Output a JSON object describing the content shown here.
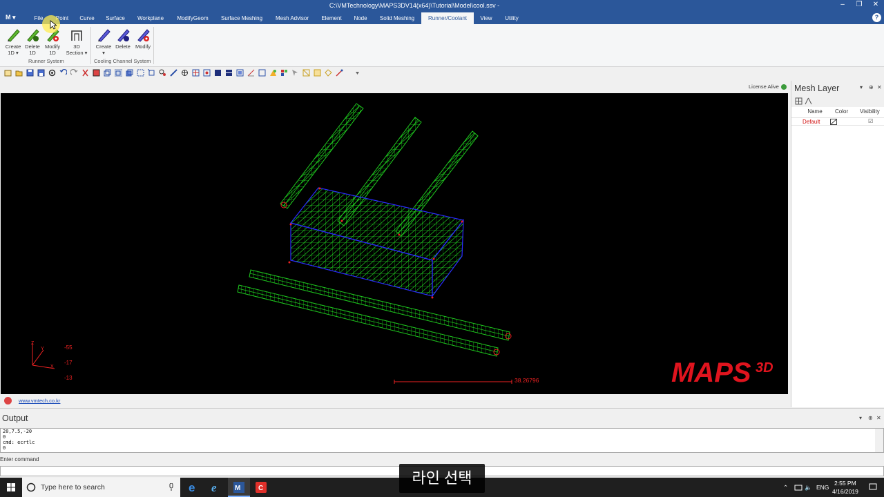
{
  "window": {
    "title": "C:\\VMTechnology\\MAPS3DV14(x64)\\Tutorial\\Model\\cool.ssv -",
    "minimize": "‒",
    "restore": "❐",
    "close": "✕"
  },
  "menu": {
    "app_label": "M ▾",
    "tabs": [
      "File",
      "Point",
      "Curve",
      "Surface",
      "Workplane",
      "ModifyGeom",
      "Surface Meshing",
      "Mesh Advisor",
      "Element",
      "Node",
      "Solid Meshing",
      "Runner/Coolant",
      "View",
      "Utility"
    ],
    "active_tab": "Runner/Coolant",
    "help": "?"
  },
  "ribbon": {
    "runner": {
      "create": "Create\n1D ▾",
      "delete": "Delete\n1D",
      "modify": "Modify\n1D",
      "section": "3D\nSection ▾",
      "group_label": "Runner System"
    },
    "cooling": {
      "create": "Create\n▾",
      "delete": "Delete",
      "modify": "Modify",
      "group_label": "Cooling Channel System"
    }
  },
  "license": {
    "text": "License Alive"
  },
  "viewport": {
    "axis_values": [
      "-55",
      "-17",
      "-13"
    ],
    "scale_value": "38.26796",
    "watermark": "MAPS",
    "watermark_sup": "3D",
    "mesh_color": "#1ec81e",
    "edge_color": "#2a2aff"
  },
  "status": {
    "link": "www.vmtech.co.kr"
  },
  "mesh_layer": {
    "title": "Mesh Layer",
    "columns": [
      "Name",
      "Color",
      "Visibility"
    ],
    "rows": [
      {
        "name": "Default",
        "visible": "☑"
      }
    ]
  },
  "output": {
    "title": "Output",
    "lines": [
      "20,7.5,-20",
      "0",
      "cmd: ecrtlc",
      "0"
    ],
    "command_label": "Enter command"
  },
  "taskbar": {
    "search_placeholder": "Type here to search",
    "time": "2:55 PM",
    "date": "4/16/2019",
    "lang": "ENG"
  },
  "caption": "라인 선택"
}
